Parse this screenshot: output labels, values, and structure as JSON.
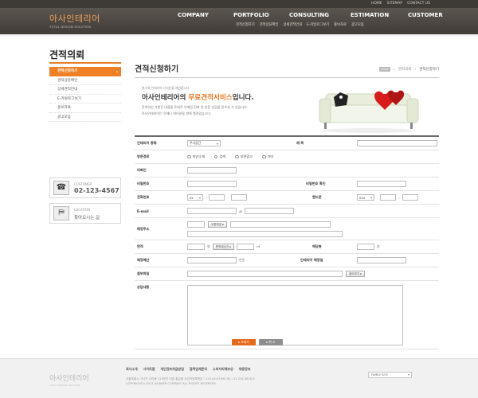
{
  "util_links": [
    "HOME",
    "SITEMAP",
    "CONTACT US"
  ],
  "logo": {
    "main": "아사인테리어",
    "sub": "TOTAL DESIGN SOLUTION"
  },
  "gnb": [
    "COMPANY",
    "PORTFOLIO",
    "CONSULTING",
    "ESTIMATION",
    "CUSTOMER"
  ],
  "sub_gnb": [
    "견적신청하기",
    "견적상담확인",
    "상세견적안내",
    "E-카달로그보기",
    "홍보자료",
    "광고모음"
  ],
  "side": {
    "title": "견적의뢰",
    "items": [
      "견적신청하기",
      "견적상담확인",
      "상세견적안내",
      "E-카달로그보기",
      "홍보자료",
      "광고모음"
    ],
    "customer_label": "CUSTOMER",
    "customer_phone": "02-123-4567",
    "location_label": "LOCATION",
    "location_text": "찾아오시는 길"
  },
  "content": {
    "title": "견적신청하기",
    "breadcrumb": [
      "HOME",
      "견적의뢰",
      "견적신청하기"
    ],
    "intro_small": "최고의 인테리어 디자인을 제안합니다.",
    "intro_title_pre": "아사인테리어의 ",
    "intro_title_hl": "무료견적서비스",
    "intro_title_post": "입니다.",
    "intro_desc_1": "문의하신 사항은 내용을 토대로 이메일,전화 및 방문 상담을 받으실 수 있습니다.",
    "intro_desc_2": "아사인테리어는 언제나 여러분을 향해 열려있습니다."
  },
  "form": {
    "interior_type_label": "인테리어 종류",
    "interior_type_value": "주거공간",
    "subject_label": "제 목",
    "visit_label": "방문경로",
    "visit_options": [
      "지인소개",
      "검색",
      "지면광고",
      "기타"
    ],
    "requester_label": "의뢰인",
    "password_label": "비밀번호",
    "password_confirm_label": "비밀번호 확인",
    "phone_label": "전화번호",
    "phone_prefix": "02",
    "phone_sep": "-",
    "mobile_label": "핸드폰",
    "mobile_prefix": "010",
    "email_label": "E-mail",
    "email_at": "@",
    "address_label": "예정주소",
    "zip_button": "우편번호 ▸",
    "area_label": "면적",
    "area_unit": "평",
    "area_button": "면적계산기 ▸",
    "area_unit2": "㎡",
    "floor_label": "해당층",
    "floor_unit": "층",
    "budget_label": "예정예산",
    "budget_unit": "만원",
    "date_label": "인테리어 예정일",
    "attach_label": "첨부파일",
    "attach_button": "찾아보기 ▸",
    "detail_label": "상담내용",
    "submit": "▸ 보내기",
    "cancel": "▸ 취 소"
  },
  "footer": {
    "logo_main": "아사인테리어",
    "logo_sub": "TOTAL DESIGN SOLUTION",
    "links": [
      "회사소개",
      "사이트맵",
      "개인정보취급방침",
      "협력업체문의",
      "소비자피해보상",
      "채용정보"
    ],
    "info_1": "서울특별시 가나구 다라동 123번지  대표:홍길동  사업자등록번호 : 123-45-67890  Tel : 01-234-5678-9",
    "info_2": "COPYRIGHT(c)2011 ASAWEB COMPANY ALL RIGHTS RESERVED.",
    "family_site": "FAMILY SITE"
  }
}
